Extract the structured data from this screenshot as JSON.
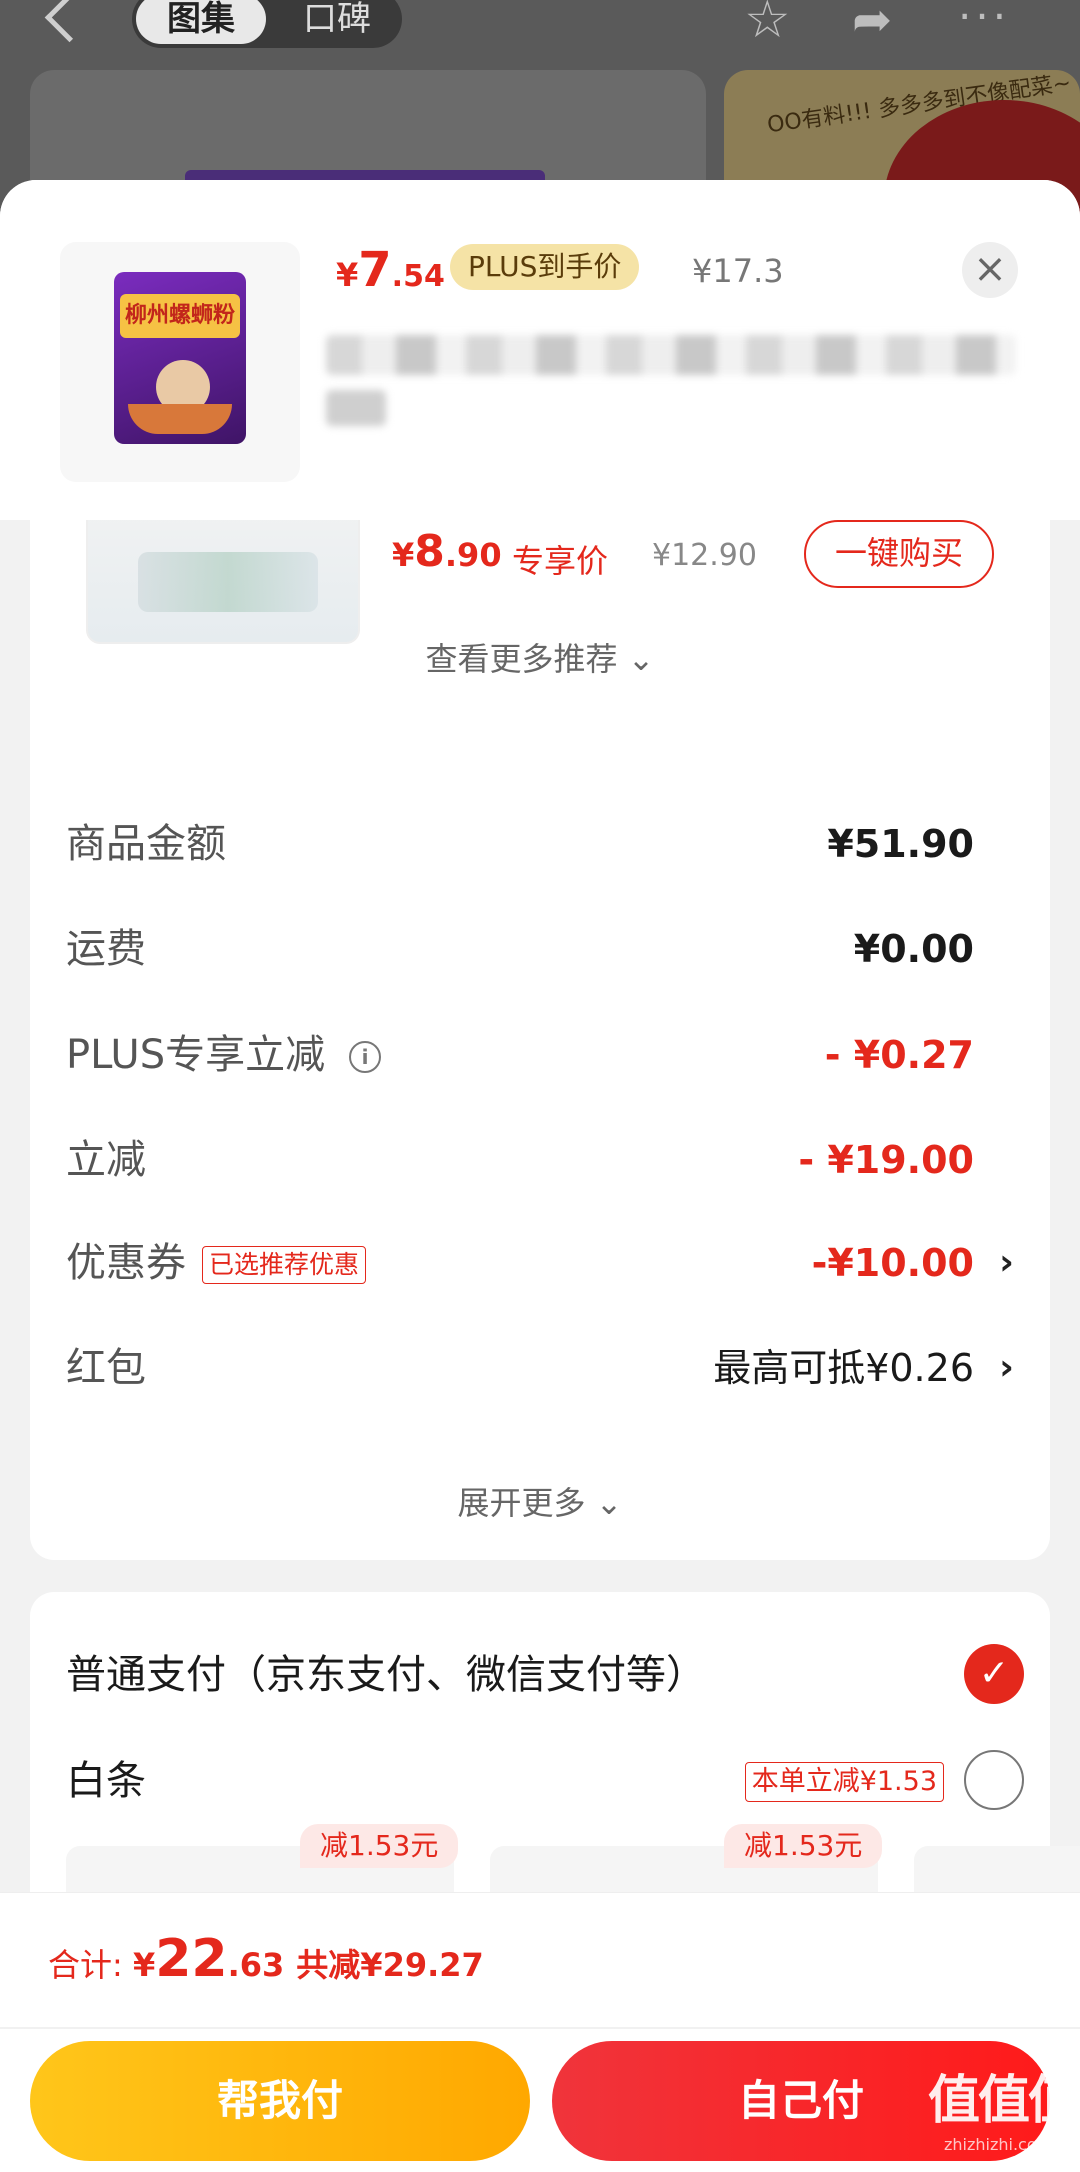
{
  "background": {
    "tabs": [
      "图集",
      "口碑"
    ],
    "promo_text": "OO有料!!! 多多多到不像配菜~"
  },
  "product": {
    "price_yen": "¥",
    "price_int": "7",
    "price_dec": ".54",
    "plus_tag": "PLUS到手价",
    "original_price": "¥17.3",
    "package_text": "柳州螺蛳粉",
    "close_label": "×"
  },
  "recommendation": {
    "price_yen": "¥",
    "price_int": "8",
    "price_dec": ".90",
    "price_label": "专享价",
    "original_price": "¥12.90",
    "buy_button": "一键购买",
    "see_more": "查看更多推荐 ⌄"
  },
  "summary": {
    "rows": [
      {
        "label": "商品金额",
        "value": "¥51.90"
      },
      {
        "label": "运费",
        "value": "¥0.00"
      },
      {
        "label": "PLUS专享立减",
        "value": "- ¥0.27",
        "info_icon": "i"
      },
      {
        "label": "立减",
        "value": "- ¥19.00"
      },
      {
        "label": "优惠券",
        "tag": "已选推荐优惠",
        "value": "-¥10.00"
      },
      {
        "label": "红包",
        "value": "最高可抵¥0.26"
      }
    ],
    "chevron": "›",
    "expand_more": "展开更多 ⌄"
  },
  "payment": {
    "normal": {
      "label": "普通支付（京东支付、微信支付等）",
      "check": "✓"
    },
    "baitiao": {
      "label": "白条",
      "tag": "本单立减¥1.53"
    },
    "installments": [
      {
        "badge": "减1.53元"
      },
      {
        "badge": "减1.53元"
      }
    ]
  },
  "bottom": {
    "total_label": "合计: ",
    "total_yen": "¥",
    "total_int": "22",
    "total_dec": ".63",
    "total_saved": "共减¥29.27",
    "help_pay": "帮我付",
    "self_pay": "自己付",
    "watermark": "值值值",
    "watermark_sub": "zhizhizhi.com"
  },
  "colors": {
    "accent_red": "#e4281c",
    "plus_gold": "#f5e3a6",
    "help_pay_yellow": "#ffb800",
    "self_pay_red": "#f0343b"
  },
  "icons": [
    "back-icon",
    "star-icon",
    "share-icon",
    "more-icon",
    "close-icon",
    "info-icon",
    "chevron-right-icon",
    "check-icon"
  ]
}
